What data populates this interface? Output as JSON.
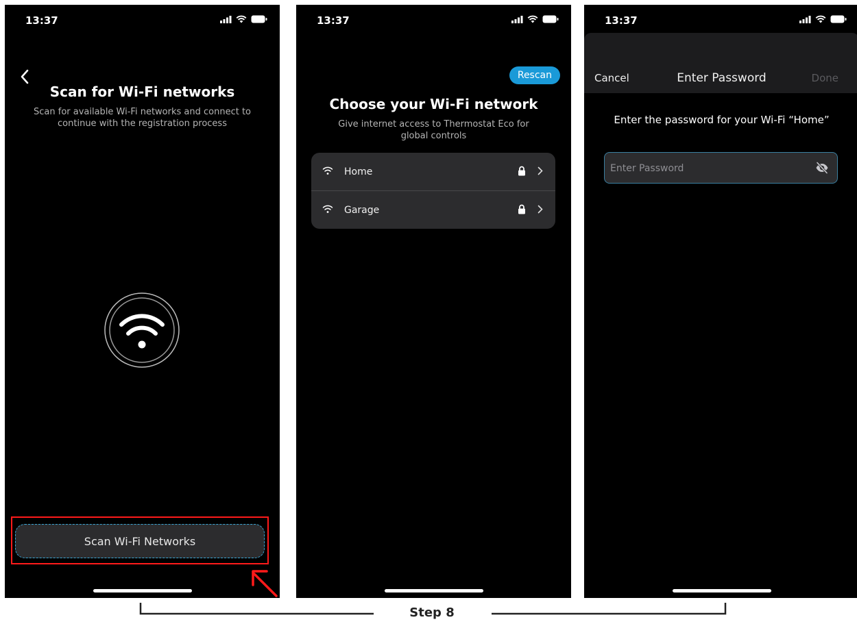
{
  "status_bar": {
    "time": "13:37"
  },
  "screen1": {
    "title": "Scan for Wi-Fi networks",
    "subtitle": "Scan for available Wi-Fi networks and connect to continue with the registration process",
    "scan_button": "Scan Wi-Fi Networks",
    "highlight_color": "#ff1a1a"
  },
  "screen2": {
    "rescan_button": "Rescan",
    "title": "Choose your Wi-Fi network",
    "subtitle": "Give internet access to Thermostat Eco for global controls",
    "networks": [
      {
        "name": "Home",
        "secured": true
      },
      {
        "name": "Garage",
        "secured": true
      }
    ],
    "accent_color": "#1a9ad8"
  },
  "screen3": {
    "cancel": "Cancel",
    "title": "Enter Password",
    "done": "Done",
    "prompt": "Enter the password for your Wi-Fi “Home”",
    "password_placeholder": "Enter Password",
    "password_value": ""
  },
  "footer": {
    "step_label": "Step 8"
  }
}
